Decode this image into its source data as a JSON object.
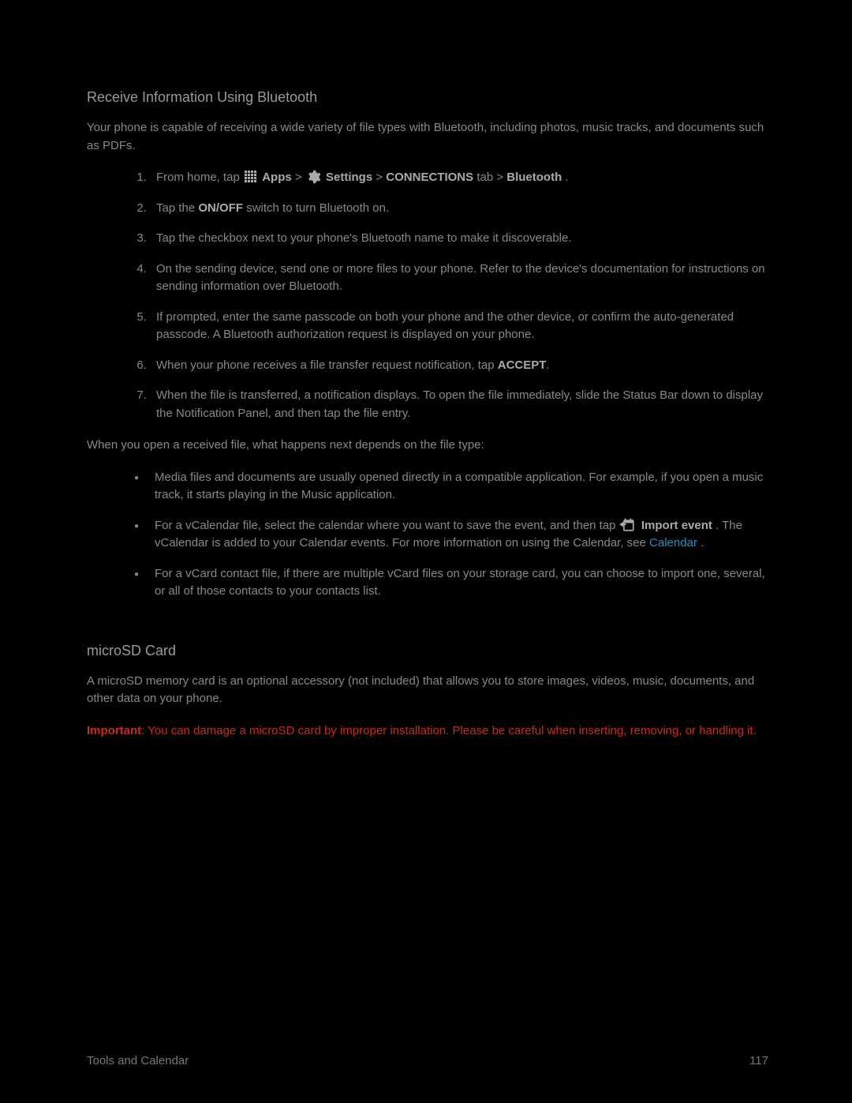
{
  "headings": {
    "receive": "Receive Information Using Bluetooth",
    "microsd": "microSD Card"
  },
  "paragraphs": {
    "intro": "Your phone is capable of receiving a wide variety of file types with Bluetooth, including photos, music tracks, and documents such as PDFs.",
    "open_received": "When you open a received file, what happens next depends on the file type:",
    "microsd_intro": "A microSD memory card is an optional accessory (not included) that allows you to store images, videos, music, documents, and other data on your phone.",
    "important_label": "Important",
    "important_text": ": You can damage a microSD card by improper installation. Please be careful when inserting, removing, or handling it."
  },
  "step1": {
    "pre": "From home, tap ",
    "apps": "Apps",
    "gt1": " > ",
    "settings": "Settings",
    "gt2": " > ",
    "conn": "CONNECTIONS",
    "tab": " tab > ",
    "bt": "Bluetooth",
    "dot": "."
  },
  "step2": {
    "pre": "Tap the ",
    "onoff": "ON/OFF",
    "post": " switch to turn Bluetooth on."
  },
  "step3": "Tap the checkbox next to your phone's Bluetooth name to make it discoverable.",
  "step4": "On the sending device, send one or more files to your phone. Refer to the device's documentation for instructions on sending information over Bluetooth.",
  "step5": "If prompted, enter the same passcode on both your phone and the other device, or confirm the auto-generated passcode. A Bluetooth authorization request is displayed on your phone.",
  "step6": {
    "pre": "When your phone receives a file transfer request notification, tap ",
    "accept": "ACCEPT",
    "dot": "."
  },
  "step7": "When the file is transferred, a notification displays. To open the file immediately, slide the Status Bar down to display the Notification Panel, and then tap the file entry.",
  "bullet1": "Media files and documents are usually opened directly in a compatible application. For example, if you open a music track, it starts playing in the Music application.",
  "bullet2": {
    "pre": "For a vCalendar file, select the calendar where you want to save the event, and then tap ",
    "importevent": "Import event",
    "mid": ". The vCalendar is added to your Calendar events. For more information on using the Calendar, see ",
    "link": "Calendar",
    "dot": "."
  },
  "bullet3": "For a vCard contact file, if there are multiple vCard files on your storage card, you can choose to import one, several, or all of those contacts to your contacts list.",
  "footer": {
    "left": "Tools and Calendar",
    "right": "117"
  }
}
